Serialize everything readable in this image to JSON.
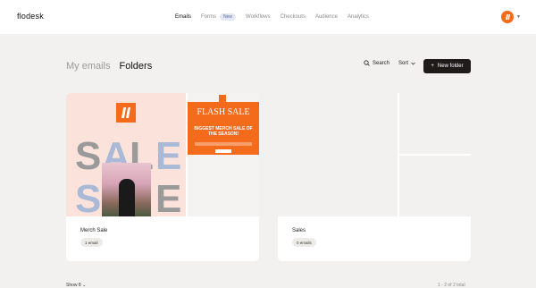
{
  "brand": "flodesk",
  "nav": {
    "items": [
      "Emails",
      "Forms",
      "Workflows",
      "Checkouts",
      "Audience",
      "Analytics"
    ],
    "badge": "New",
    "active": "Emails"
  },
  "header": {
    "tabs": [
      "My emails",
      "Folders"
    ],
    "active_tab": "Folders",
    "search_label": "Search",
    "sort_label": "Sort",
    "new_folder_label": "New folder"
  },
  "folders": [
    {
      "name": "Merch Sale",
      "count": "1 email",
      "preview": {
        "sale_text": "SALE",
        "flash_title": "FLASH SALE",
        "flash_subtitle": "BIGGEST MERCH SALE OF THE SEASON!"
      }
    },
    {
      "name": "Sales",
      "count": "0 emails"
    }
  ],
  "footer": {
    "show_label": "Show 8",
    "total_label": "1 - 2 of 2 total"
  },
  "colors": {
    "accent": "#f36b1b",
    "dark_button": "#1e1b19",
    "background": "#f2f1ef"
  }
}
